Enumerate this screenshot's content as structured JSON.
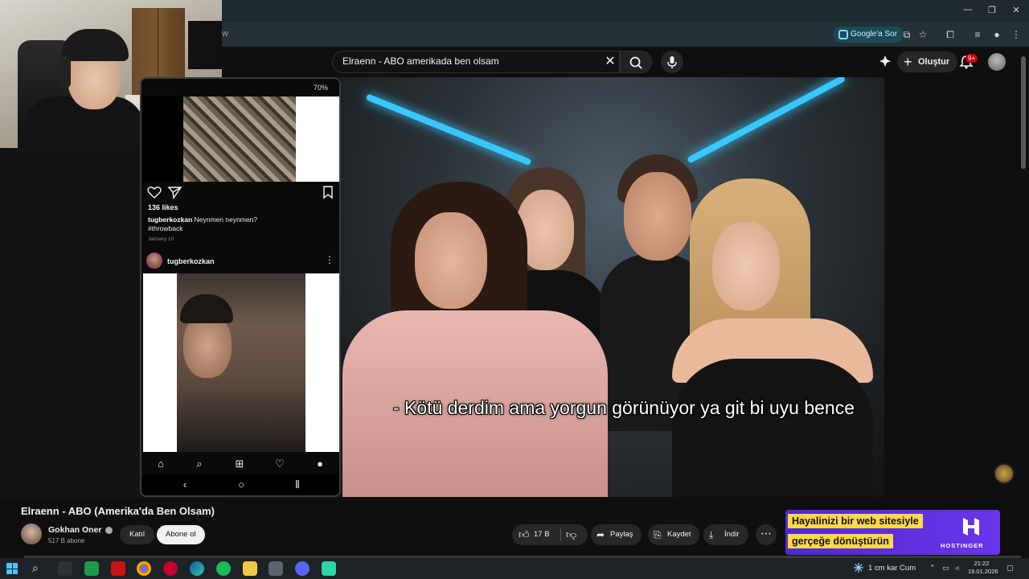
{
  "browser": {
    "address_fragment": "w",
    "ask_google_label": "Google'a Sor",
    "window_controls": [
      "—",
      "❐",
      "✕"
    ]
  },
  "youtube_header": {
    "search_query": "Elraenn - ABO amerikada ben olsam",
    "create_label": "Oluştur",
    "notification_badge": "9+"
  },
  "video": {
    "subtitle": "- Kötü derdim ama yorgun görünüyor ya git bi uyu bence"
  },
  "phone_overlay": {
    "status_battery": "70%",
    "post1": {
      "likes": "136 likes",
      "caption_user": "tugberkozkan",
      "caption_text": " Neynmen neynmen?",
      "hashtag": "#throwback",
      "date": "January 10"
    },
    "post2": {
      "username": "tugberkozkan"
    }
  },
  "video_info": {
    "title": "Elraenn - ABO (Amerika'da Ben Olsam)",
    "channel_name": "Gokhan Oner",
    "subscribers": "517 B abone",
    "join_label": "Katıl",
    "subscribe_label": "Abone ol",
    "like_count": "17 B",
    "share_label": "Paylaş",
    "save_label": "Kaydet",
    "download_label": "İndir"
  },
  "ad": {
    "line1": "Hayalinizi bir web sitesiyle",
    "line2": "gerçeğe dönüştürün",
    "brand": "HOSTINGER",
    "colors": {
      "background": "#5b30e0",
      "highlight": "#ffd84d"
    }
  },
  "taskbar": {
    "weather": "1 cm kar Cum",
    "time": "21:22",
    "date": "19.01.2026"
  },
  "colors": {
    "yt_background": "#0f0f0f",
    "led_blue": "#38c8ff",
    "notification_red": "#cc0000"
  }
}
